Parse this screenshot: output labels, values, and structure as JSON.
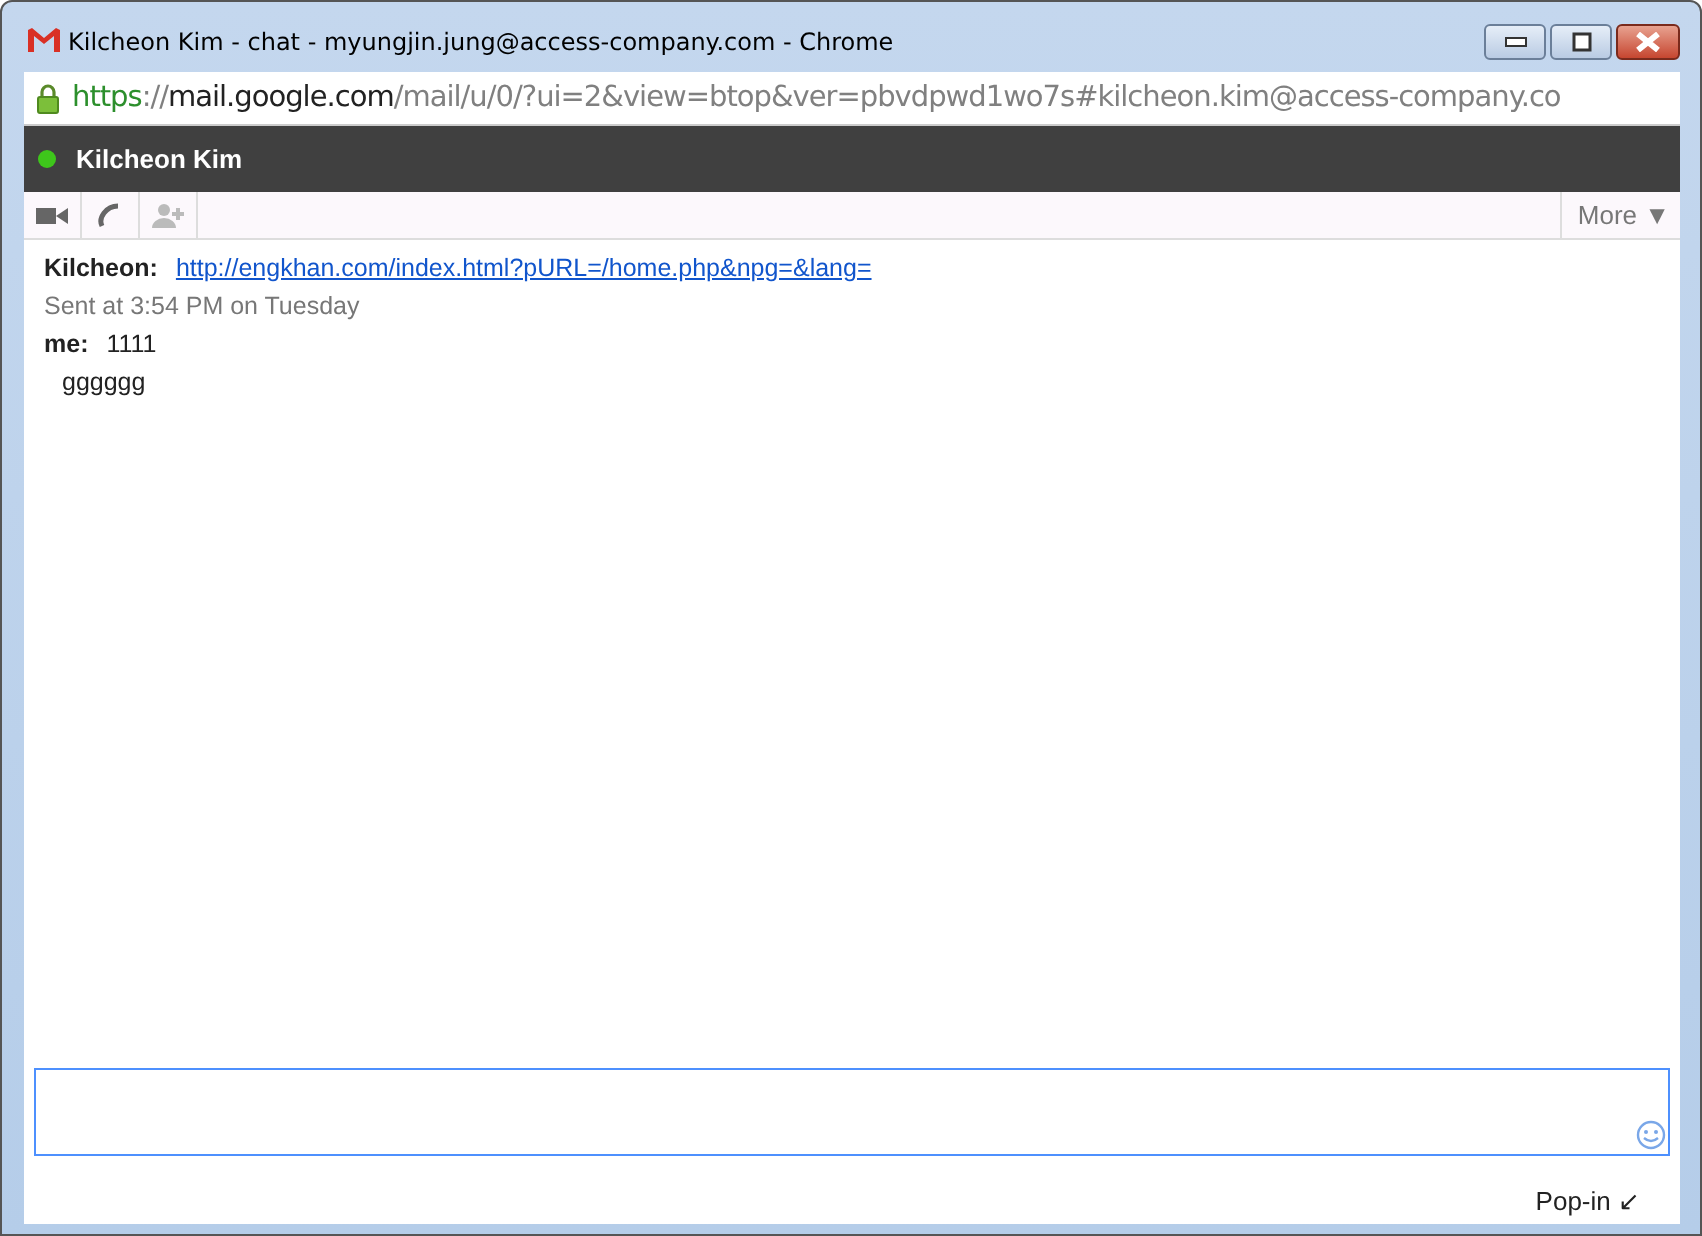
{
  "window": {
    "title": "Kilcheon Kim - chat - myungjin.jung@access-company.com - Chrome"
  },
  "address_bar": {
    "scheme": "https",
    "separator": "://",
    "host": "mail.google.com",
    "path": "/mail/u/0/?ui=2&view=btop&ver=pbvdpwd1wo7s#kilcheon.kim@access-company.co"
  },
  "chat_header": {
    "contact": "Kilcheon Kim",
    "online": true
  },
  "toolbar": {
    "more": "More ▼"
  },
  "messages": [
    {
      "kind": "link",
      "sender": "Kilcheon:",
      "text": "http://engkhan.com/index.html?pURL=/home.php&npg=&lang="
    },
    {
      "kind": "status",
      "text": "Sent at 3:54 PM on Tuesday"
    },
    {
      "kind": "text",
      "sender": "me:",
      "text": "1111"
    },
    {
      "kind": "continuation",
      "text": "gggggg"
    }
  ],
  "footer": {
    "pop_in": "Pop-in ↙"
  }
}
